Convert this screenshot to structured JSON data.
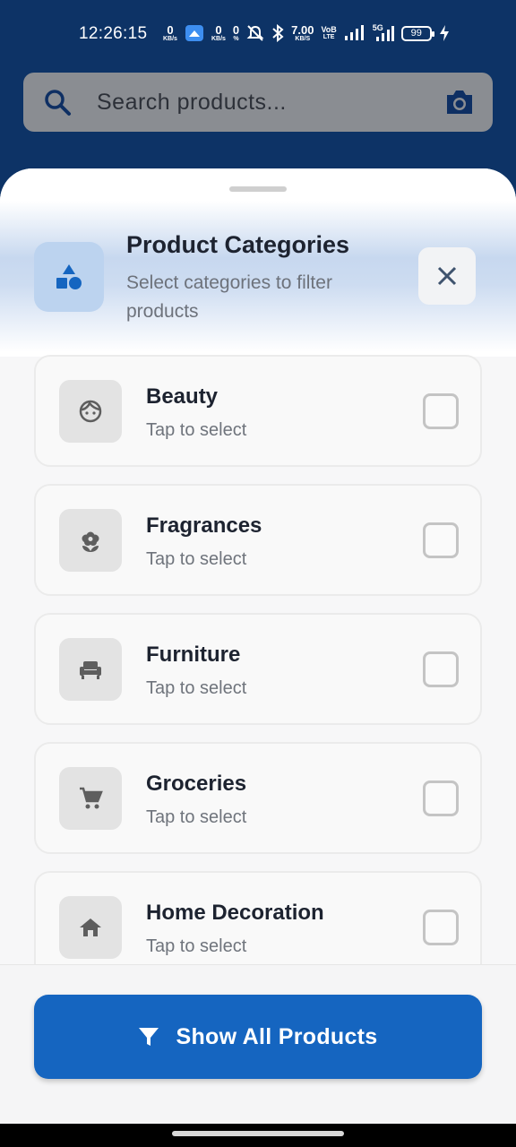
{
  "status_bar": {
    "time": "12:26:15",
    "net1_value": "0",
    "net1_unit": "KB/s",
    "net2_value": "0",
    "net2_unit": "KB/s",
    "net3_value": "0",
    "net3_unit": "%",
    "speed_value": "7.00",
    "speed_unit": "KB/S",
    "volte": "VoB",
    "volte_sub": "LTE",
    "network": "5G",
    "battery": "99"
  },
  "search": {
    "placeholder": "Search products..."
  },
  "sheet": {
    "title": "Product Categories",
    "subtitle": "Select categories to filter products"
  },
  "categories": [
    {
      "name": "Beauty",
      "hint": "Tap to select",
      "icon": "face-icon",
      "checked": false
    },
    {
      "name": "Fragrances",
      "hint": "Tap to select",
      "icon": "flower-icon",
      "checked": false
    },
    {
      "name": "Furniture",
      "hint": "Tap to select",
      "icon": "armchair-icon",
      "checked": false
    },
    {
      "name": "Groceries",
      "hint": "Tap to select",
      "icon": "cart-icon",
      "checked": false
    },
    {
      "name": "Home Decoration",
      "hint": "Tap to select",
      "icon": "home-icon",
      "checked": false
    }
  ],
  "footer": {
    "show_all_label": "Show All Products"
  },
  "colors": {
    "primary": "#1565c0",
    "header_bg": "#0d3366"
  }
}
